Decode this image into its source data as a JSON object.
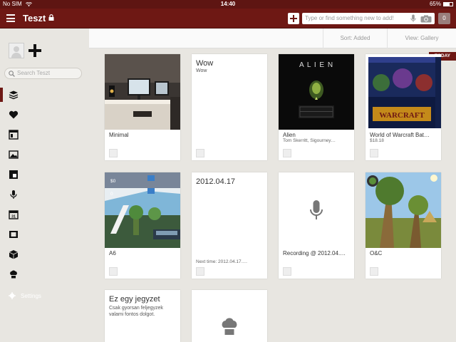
{
  "status_bar": {
    "carrier": "No SIM",
    "time": "14:40",
    "battery": "65%",
    "battery_level": 0.65
  },
  "header": {
    "title": "Teszt",
    "search_placeholder": "Type or find something new to add!",
    "count": "0"
  },
  "sortbar": {
    "sort_label": "Sort: Added",
    "view_label": "View: Gallery"
  },
  "sidebar": {
    "search_placeholder": "Search Teszt",
    "settings_label": "Settings",
    "items": [
      {
        "icon": "layers-icon"
      },
      {
        "icon": "heart-icon"
      },
      {
        "icon": "layout-icon"
      },
      {
        "icon": "image-icon"
      },
      {
        "icon": "cast-icon"
      },
      {
        "icon": "microphone-icon"
      },
      {
        "icon": "calendar-icon"
      },
      {
        "icon": "film-icon"
      },
      {
        "icon": "box-icon"
      },
      {
        "icon": "chef-hat-icon"
      }
    ],
    "calendar_day": "31"
  },
  "today_badge": "TODAY",
  "cards": [
    {
      "title": "Minimal",
      "subtitle": ""
    },
    {
      "heading": "Wow",
      "body": "Wow"
    },
    {
      "title": "Alien",
      "subtitle": "Tom Skerritt, Sigourney…",
      "poster_text": "A L I E N"
    },
    {
      "title": "World of Warcraft Bat…",
      "subtitle": "$18.18",
      "cover_text": "WARCRAFT"
    },
    {
      "title": "A6",
      "subtitle": "",
      "hud_values": [
        "$0",
        "0"
      ]
    },
    {
      "heading": "2012.04.17",
      "footer": "Next time: 2012.04.17…."
    },
    {
      "title": "Recording @ 2012.04.…",
      "subtitle": ""
    },
    {
      "title": "O&C",
      "subtitle": ""
    },
    {
      "heading": "Ez egy jegyzet",
      "body": "Csak gyorsan feljegyzek valami fontos dolgot."
    },
    {
      "title": "",
      "subtitle": ""
    }
  ],
  "colors": {
    "accent": "#6e1814",
    "background": "#e8e6e1"
  }
}
